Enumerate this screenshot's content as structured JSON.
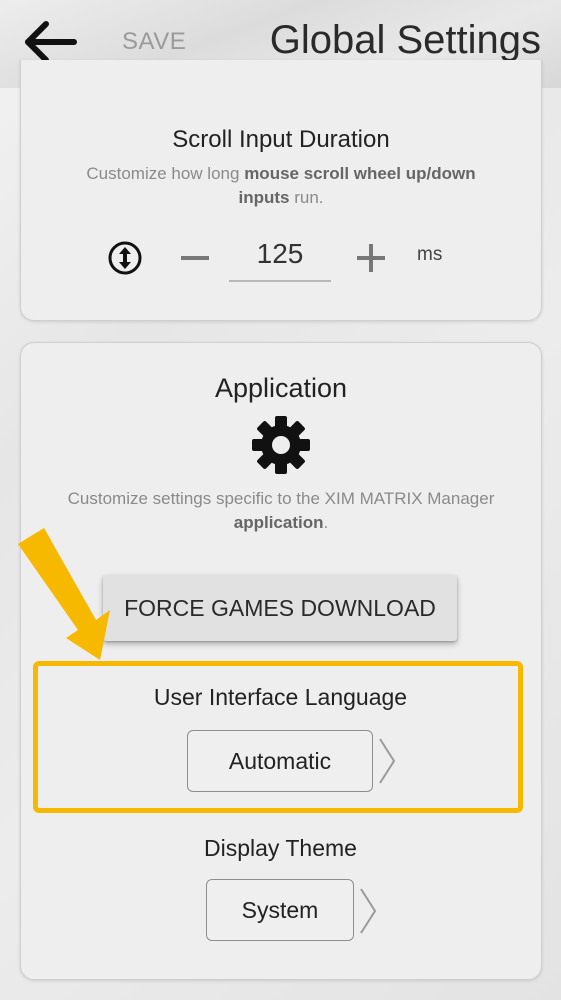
{
  "header": {
    "back_icon": "arrow-left-icon",
    "save_label": "SAVE",
    "title": "Global Settings"
  },
  "scroll_card": {
    "title": "Scroll Input Duration",
    "desc_part1": "Customize how long ",
    "desc_bold1": "mouse scroll wheel up/down inputs",
    "desc_part2": " run.",
    "icon": "scroll-updown-icon",
    "value": "125",
    "unit": "ms"
  },
  "app_card": {
    "title": "Application",
    "icon": "gear-icon",
    "desc_part1": "Customize settings specific to the XIM MATRIX Manager ",
    "desc_bold1": "application",
    "desc_part2": ".",
    "force_button_label": "FORCE GAMES DOWNLOAD",
    "language_label": "User Interface Language",
    "language_value": "Automatic",
    "theme_label": "Display Theme",
    "theme_value": "System"
  },
  "colors": {
    "highlight": "#f7b800",
    "save_disabled": "#9a9a9a"
  }
}
